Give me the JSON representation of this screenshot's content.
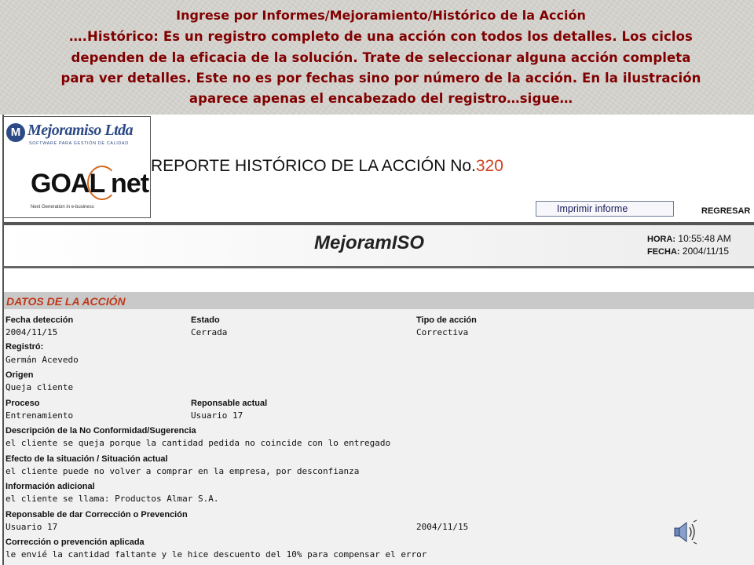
{
  "caption": {
    "title": "Ingrese por Informes/Mejoramiento/Histórico  de la Acción",
    "lines": [
      "….Histórico: Es un registro completo de una acción con todos los detalles. Los ciclos",
      "dependen de la eficacia de la solución. Trate de seleccionar alguna acción completa",
      "para ver detalles. Este no es por fechas sino por número de la acción.  En la ilustración",
      "aparece apenas el encabezado del registro…sigue…"
    ]
  },
  "header": {
    "logo_mejoramiso": "Mejoramiso Ltda",
    "logo_mejoramiso_sub": "SOFTWARE PARA GESTIÓN DE CALIDAD",
    "logo_goalnet": "GOAL net",
    "logo_goalnet_sub": "Next Generation in e-business",
    "report_title": "REPORTE HISTÓRICO DE LA ACCIÓN No.",
    "action_number": "320",
    "print_button": "Imprimir informe",
    "back_link": "REGRESAR"
  },
  "band": {
    "app_name": "MejoramISO",
    "hora_label": "HORA:",
    "hora_value": "10:55:48 AM",
    "fecha_label": "FECHA:",
    "fecha_value": "2004/11/15"
  },
  "section": {
    "title": "DATOS DE LA ACCIÓN",
    "fields": {
      "fecha_deteccion": {
        "label": "Fecha detección",
        "value": "2004/11/15"
      },
      "estado": {
        "label": "Estado",
        "value": "Cerrada"
      },
      "tipo_accion": {
        "label": "Tipo de acción",
        "value": "Correctiva"
      },
      "registro": {
        "label": "Registró:",
        "value": "Germán Acevedo"
      },
      "origen": {
        "label": "Origen",
        "value": "Queja cliente"
      },
      "proceso": {
        "label": "Proceso",
        "value": "Entrenamiento"
      },
      "responsable": {
        "label": "Reponsable actual",
        "value": "Usuario 17"
      },
      "descripcion": {
        "label": "Descripción de la No Conformidad/Sugerencia",
        "value": "el cliente se queja porque la cantidad pedida no coincide con lo entregado"
      },
      "efecto": {
        "label": "Efecto de la situación / Situación actual",
        "value": "el cliente puede no volver a comprar en la empresa, por desconfianza"
      },
      "info": {
        "label": "Información adicional",
        "value": "el cliente se llama: Productos Almar S.A."
      },
      "resp_correccion": {
        "label": "Reponsable de dar Corrección o Prevención",
        "value": "Usuario 17",
        "date": "2004/11/15"
      },
      "correccion": {
        "label": "Corrección o prevención aplicada",
        "value": "le envié la cantidad faltante y le hice descuento del 10% para compensar el error"
      }
    }
  }
}
